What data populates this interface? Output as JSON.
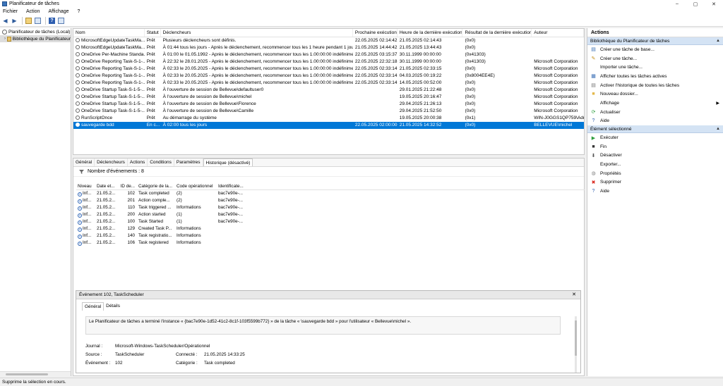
{
  "window": {
    "title": "Planificateur de tâches",
    "controls": [
      "–",
      "▢",
      "✕"
    ]
  },
  "menu": [
    "Fichier",
    "Action",
    "Affichage",
    "?"
  ],
  "tree": {
    "root": "Planificateur de tâches (Local)",
    "child": "Bibliothèque du Planificateur"
  },
  "tasklist": {
    "columns": [
      "Nom",
      "Statut",
      "Déclencheurs",
      "Prochaine exécution",
      "Heure de la dernière exécution",
      "Résultat de la dernière exécution",
      "Auteur"
    ],
    "rows": [
      [
        "MicrosoftEdgeUpdateTaskMa...",
        "Prêt",
        "Plusieurs déclencheurs sont définis.",
        "22.05.2025 02:14:42",
        "21.05.2025 02:14:43",
        "(0x0)",
        ""
      ],
      [
        "MicrosoftEdgeUpdateTaskMa...",
        "Prêt",
        "À 01:44 tous les jours - Après le déclenchement, recommencer tous les 1 heure pendant 1 jour.",
        "21.05.2025 14:44:42",
        "21.05.2025 13:44:43",
        "(0x0)",
        ""
      ],
      [
        "OneDrive Per-Machine Standa...",
        "Prêt",
        "À 01:00 le 01.05.1992 - Après le déclenchement, recommencer tous les 1.00:00:00 indéfiniment.",
        "22.05.2025 03:15:37",
        "30.11.1999 00:00:00",
        "(0x41303)",
        ""
      ],
      [
        "OneDrive Reporting Task-S-1-...",
        "Prêt",
        "À 22:32 le 28.01.2025 - Après le déclenchement, recommencer tous les 1.00:00:00 indéfiniment.",
        "22.05.2025 22:32:18",
        "30.11.1999 00:00:00",
        "(0x41303)",
        "Microsoft Corporation"
      ],
      [
        "OneDrive Reporting Task-S-1-...",
        "Prêt",
        "À 02:33 le 20.05.2025 - Après le déclenchement, recommencer tous les 1.00:00:00 indéfiniment.",
        "22.05.2025 02:33:14",
        "21.05.2025 02:33:15",
        "(0x0)",
        "Microsoft Corporation"
      ],
      [
        "OneDrive Reporting Task-S-1-...",
        "Prêt",
        "À 02:33 le 20.05.2025 - Après le déclenchement, recommencer tous les 1.00:00:00 indéfiniment.",
        "22.05.2025 02:33:14",
        "04.03.2025 00:19:22",
        "(0x8004EE4E)",
        "Microsoft Corporation"
      ],
      [
        "OneDrive Reporting Task-S-1-...",
        "Prêt",
        "À 02:33 le 20.05.2025 - Après le déclenchement, recommencer tous les 1.00:00:00 indéfiniment.",
        "22.05.2025 02:33:14",
        "14.05.2025 00:52:00",
        "(0x0)",
        "Microsoft Corporation"
      ],
      [
        "OneDrive Startup Task-S-1-5-...",
        "Prêt",
        "À l'ouverture de session de Bellevue\\defaultuser0",
        "",
        "29.01.2025 21:22:48",
        "(0x0)",
        "Microsoft Corporation"
      ],
      [
        "OneDrive Startup Task-S-1-5-...",
        "Prêt",
        "À l'ouverture de session de Bellevue\\michel",
        "",
        "19.05.2025 20:16:47",
        "(0x0)",
        "Microsoft Corporation"
      ],
      [
        "OneDrive Startup Task-S-1-5-...",
        "Prêt",
        "À l'ouverture de session de Bellevue\\Florence",
        "",
        "29.04.2025 21:26:13",
        "(0x0)",
        "Microsoft Corporation"
      ],
      [
        "OneDrive Startup Task-S-1-5-...",
        "Prêt",
        "À l'ouverture de session de Bellevue\\Camille",
        "",
        "29.04.2025 21:52:50",
        "(0x0)",
        "Microsoft Corporation"
      ],
      [
        "RunScriptOnce",
        "Prêt",
        "Au démarrage du système",
        "",
        "19.05.2025 20:00:38",
        "(0x1)",
        "WIN-J0GGS1QP759\\Admi..."
      ],
      [
        "sauvegarde bdd",
        "En c...",
        "À 02:00 tous les jours",
        "22.05.2025 02:00:00",
        "21.05.2025 14:32:52",
        "(0x0)",
        "BELLEVUE\\michel"
      ]
    ]
  },
  "detail_tabs": [
    "Général",
    "Déclencheurs",
    "Actions",
    "Conditions",
    "Paramètres",
    "Historique (désactivé)"
  ],
  "history": {
    "count_label": "Nombre d'événements : 8",
    "columns": [
      "Niveau",
      "Date et...",
      "ID de...",
      "Catégorie de la...",
      "Code opérationnel",
      "Identificate..."
    ],
    "rows": [
      [
        "Inf...",
        "21.05.2...",
        "102",
        "Task completed",
        "(2)",
        "bac7e90e-..."
      ],
      [
        "Inf...",
        "21.05.2...",
        "201",
        "Action comple...",
        "(2)",
        "bac7e90e-..."
      ],
      [
        "Inf...",
        "21.05.2...",
        "110",
        "Task triggered ...",
        "Informations",
        "bac7e90e-..."
      ],
      [
        "Inf...",
        "21.05.2...",
        "200",
        "Action started",
        "(1)",
        "bac7e90e-..."
      ],
      [
        "Inf...",
        "21.05.2...",
        "100",
        "Task Started",
        "(1)",
        "bac7e90e-..."
      ],
      [
        "Inf...",
        "21.05.2...",
        "129",
        "Created Task P...",
        "Informations",
        ""
      ],
      [
        "Inf...",
        "21.05.2...",
        "140",
        "Task registratio...",
        "Informations",
        ""
      ],
      [
        "Inf...",
        "21.05.2...",
        "106",
        "Task registered",
        "Informations",
        ""
      ]
    ]
  },
  "event": {
    "title": "Événement 102, TaskScheduler",
    "tabs": [
      "Général",
      "Détails"
    ],
    "message": "Le Planificateur de tâches a terminé l'instance « {bac7e90e-1d52-41c2-8c1f-103f5599b772} » de la tâche « \\sauvegarde bdd » pour l'utilisateur « Bellevue\\michel ».",
    "journal_label": "Journal :",
    "journal_value": "Microsoft-Windows-TaskScheduler/Opérationnel",
    "source_label": "Source :",
    "source_value": "TaskScheduler",
    "connected_label": "Connecté :",
    "connected_value": "21.05.2025 14:33:25",
    "event_label": "Événement :",
    "event_value": "102",
    "category_label": "Catégorie :",
    "category_value": "Task completed"
  },
  "actions": {
    "title": "Actions",
    "section1": "Bibliothèque du Planificateur de tâches",
    "items1": [
      {
        "label": "Créer une tâche de base...",
        "icon": "create-basic-task-icon"
      },
      {
        "label": "Créer une tâche...",
        "icon": "create-task-icon"
      },
      {
        "label": "Importer une tâche...",
        "icon": ""
      },
      {
        "label": "Afficher toutes les tâches actives",
        "icon": "running-tasks-icon"
      },
      {
        "label": "Activer l'historique de toutes les tâches",
        "icon": "history-icon"
      },
      {
        "label": "Nouveau dossier...",
        "icon": "folder-icon"
      },
      {
        "label": "Affichage",
        "icon": "",
        "submenu": "▶"
      },
      {
        "label": "Actualiser",
        "icon": "refresh-icon"
      },
      {
        "label": "Aide",
        "icon": "help-icon"
      }
    ],
    "section2": "Élément sélectionné",
    "items2": [
      {
        "label": "Exécuter",
        "icon": "run-icon"
      },
      {
        "label": "Fin",
        "icon": "stop-icon"
      },
      {
        "label": "Désactiver",
        "icon": "disable-icon"
      },
      {
        "label": "Exporter...",
        "icon": ""
      },
      {
        "label": "Propriétés",
        "icon": "properties-icon"
      },
      {
        "label": "Supprimer",
        "icon": "delete-icon"
      },
      {
        "label": "Aide",
        "icon": "help-icon"
      }
    ]
  },
  "status": "Supprime la sélection en cours.",
  "colors": {
    "selection": "#0078d7",
    "section_bg": "#d4e3f4",
    "delete_red": "#d9261c",
    "run_green": "#2e9e3e"
  }
}
